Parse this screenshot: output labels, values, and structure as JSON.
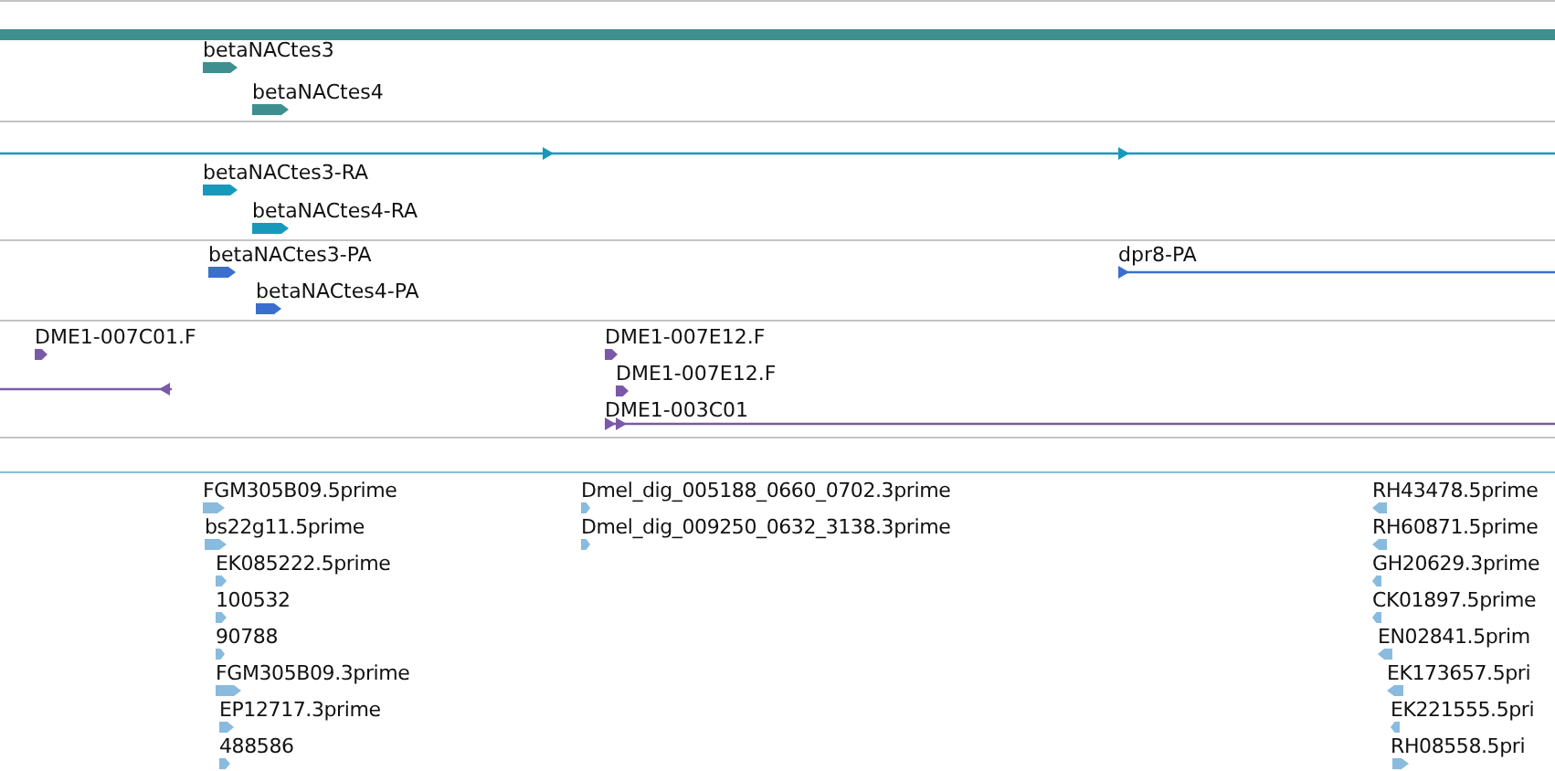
{
  "tracks": [
    {
      "color": "#3f8f8f",
      "features": [
        {
          "kind": "bar"
        },
        {
          "kind": "block",
          "label": "betaNACtes3",
          "reverse": false
        },
        {
          "kind": "block",
          "label": "betaNACtes4",
          "reverse": false
        }
      ]
    },
    {
      "color": "#1899bb",
      "features": [
        {
          "kind": "line",
          "reverse": false
        },
        {
          "kind": "block",
          "label": "betaNACtes3-RA",
          "reverse": false
        },
        {
          "kind": "block",
          "label": "betaNACtes4-RA",
          "reverse": false
        }
      ]
    },
    {
      "color": "#3a6fd0",
      "features": [
        {
          "kind": "block",
          "label": "betaNACtes3-PA",
          "reverse": false
        },
        {
          "kind": "block",
          "label": "betaNACtes4-PA",
          "reverse": false
        },
        {
          "kind": "line",
          "label": "dpr8-PA",
          "reverse": false
        }
      ]
    },
    {
      "color": "#7a5aa8",
      "features": [
        {
          "kind": "block",
          "label": "DME1-007C01.F",
          "reverse": false
        },
        {
          "kind": "line",
          "reverse": true
        },
        {
          "kind": "block",
          "label": "DME1-007E12.F",
          "reverse": false
        },
        {
          "kind": "block",
          "label": "DME1-007E12.F",
          "reverse": false
        },
        {
          "kind": "line",
          "label": "DME1-003C01",
          "reverse": false
        }
      ]
    },
    {
      "color": "#88bbdd",
      "features": [
        {
          "kind": "block",
          "label": "FGM305B09.5prime",
          "reverse": false
        },
        {
          "kind": "block",
          "label": "bs22g11.5prime",
          "reverse": false
        },
        {
          "kind": "block",
          "label": "EK085222.5prime",
          "reverse": false
        },
        {
          "kind": "block",
          "label": "100532",
          "reverse": false
        },
        {
          "kind": "block",
          "label": "90788",
          "reverse": false
        },
        {
          "kind": "block",
          "label": "FGM305B09.3prime",
          "reverse": false
        },
        {
          "kind": "block",
          "label": "EP12717.3prime",
          "reverse": false
        },
        {
          "kind": "block",
          "label": "488586",
          "reverse": false
        },
        {
          "kind": "block",
          "label": "Dmel_dig_005188_0660_0702.3prime",
          "reverse": false
        },
        {
          "kind": "block",
          "label": "Dmel_dig_009250_0632_3138.3prime",
          "reverse": false
        },
        {
          "kind": "block",
          "label": "RH43478.5prime",
          "reverse": true
        },
        {
          "kind": "block",
          "label": "RH60871.5prime",
          "reverse": true
        },
        {
          "kind": "block",
          "label": "GH20629.3prime",
          "reverse": true
        },
        {
          "kind": "block",
          "label": "CK01897.5prime",
          "reverse": true
        },
        {
          "kind": "block",
          "label": "EN02841.5prim",
          "reverse": true
        },
        {
          "kind": "block",
          "label": "EK173657.5pri",
          "reverse": true
        },
        {
          "kind": "block",
          "label": "EK221555.5pri",
          "reverse": true
        },
        {
          "kind": "block",
          "label": "RH08558.5pri",
          "reverse": false
        }
      ]
    }
  ]
}
